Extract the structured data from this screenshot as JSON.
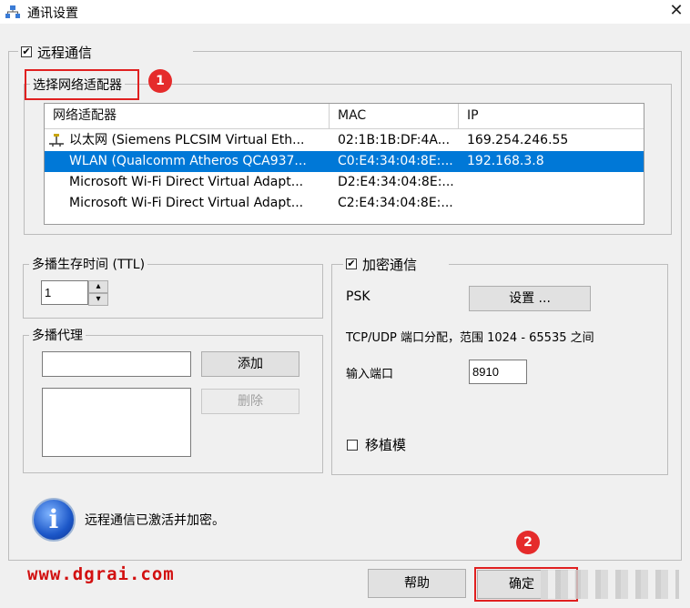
{
  "window": {
    "title": "通讯设置",
    "close": "✕"
  },
  "remote": {
    "checked": true,
    "label": "远程通信"
  },
  "adapter_group": {
    "label": "选择网络适配器",
    "badge": "1",
    "columns": [
      "网络适配器",
      "MAC",
      "IP"
    ],
    "rows": [
      {
        "name": "以太网 (Siemens PLCSIM Virtual Eth...",
        "mac": "02:1B:1B:DF:4A...",
        "ip": "169.254.246.55",
        "selected": false,
        "has_icon": true
      },
      {
        "name": "WLAN (Qualcomm Atheros QCA937...",
        "mac": "C0:E4:34:04:8E:...",
        "ip": "192.168.3.8",
        "selected": true,
        "has_icon": false
      },
      {
        "name": "Microsoft Wi-Fi Direct Virtual Adapt...",
        "mac": "D2:E4:34:04:8E:...",
        "ip": "",
        "selected": false,
        "has_icon": false
      },
      {
        "name": "Microsoft Wi-Fi Direct Virtual Adapt...",
        "mac": "C2:E4:34:04:8E:...",
        "ip": "",
        "selected": false,
        "has_icon": false
      }
    ]
  },
  "ttl": {
    "label": "多播生存时间 (TTL)",
    "value": "1",
    "up": "▴",
    "down": "▾"
  },
  "proxy": {
    "label": "多播代理",
    "add": "添加",
    "delete": "删除",
    "input_value": ""
  },
  "encrypt": {
    "checked": true,
    "label": "加密通信",
    "psk_label": "PSK",
    "settings_button": "设置 ...",
    "range_text": "TCP/UDP 端口分配，范围 1024 - 65535 之间",
    "port_label": "输入端口",
    "port_value": "8910",
    "legacy_checked": false,
    "legacy_label": "移植模"
  },
  "info": {
    "message": "远程通信已激活并加密。",
    "icon_glyph": "i"
  },
  "footer": {
    "help": "帮助",
    "ok": "确定",
    "badge": "2"
  },
  "watermark": "www.dgrai.com",
  "colors": {
    "selection": "#0078d7",
    "annotation_red": "#e02020",
    "watermark": "#d21010"
  }
}
